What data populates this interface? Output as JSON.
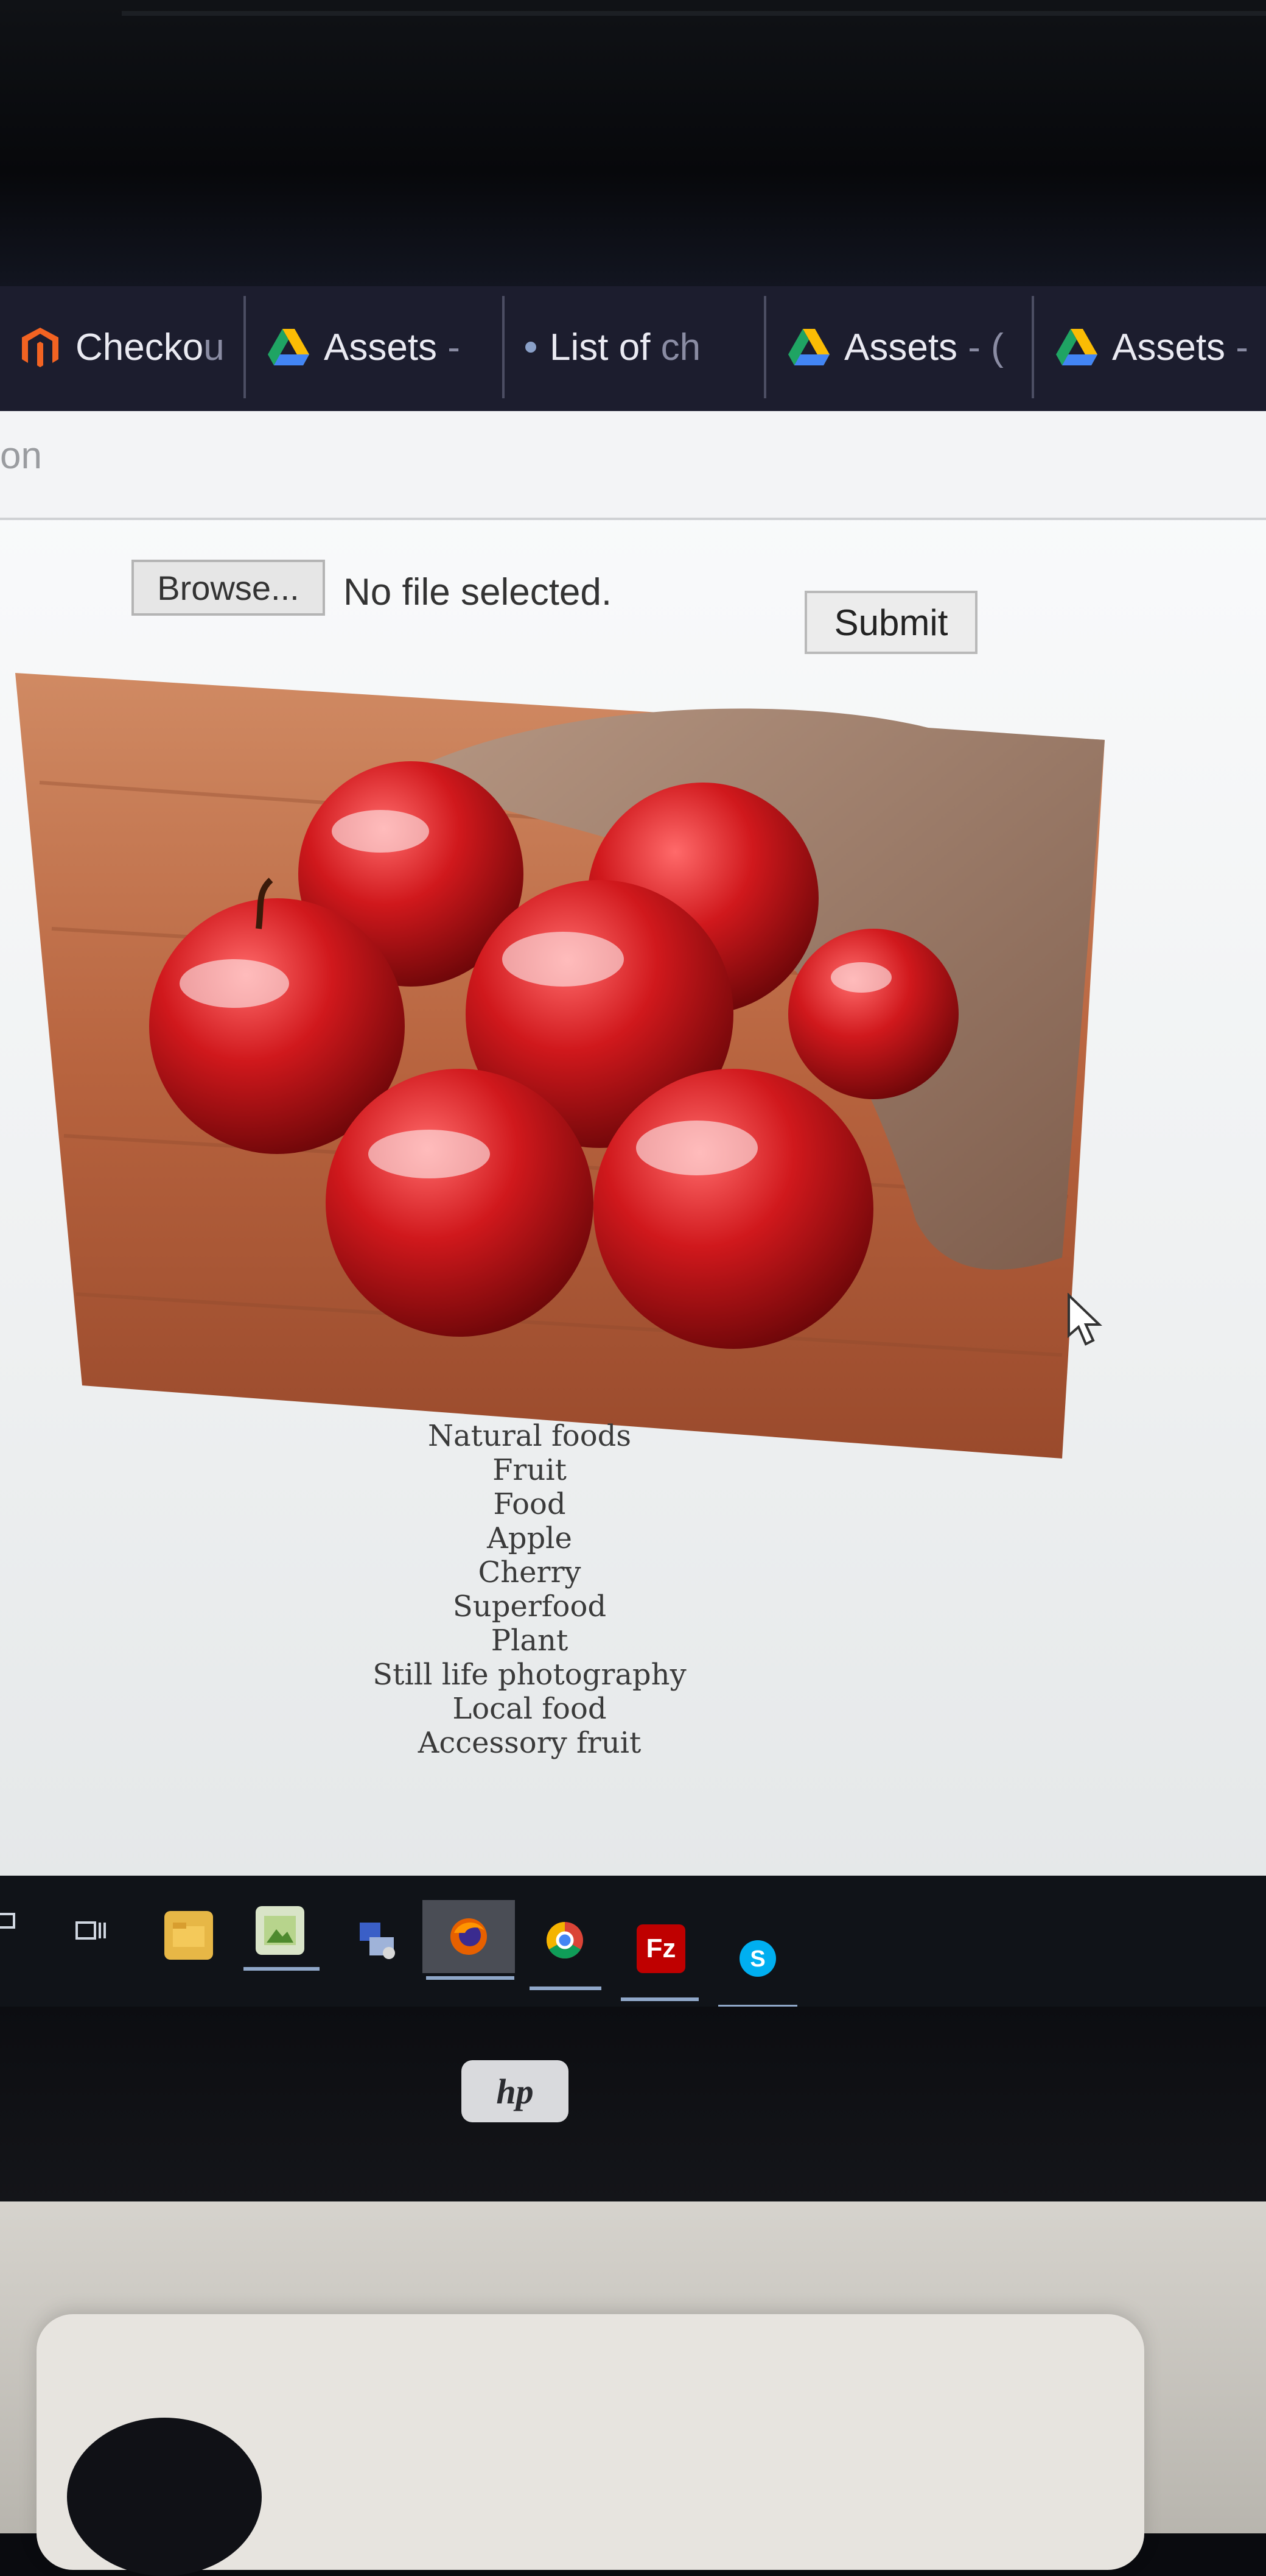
{
  "browser": {
    "tabs": [
      {
        "label": "Checko",
        "faded": "u",
        "icon": "magento-icon"
      },
      {
        "label": "Assets",
        "faded": " -",
        "icon": "google-drive-icon"
      },
      {
        "label": "List of",
        "faded": " ch",
        "icon": "page-icon"
      },
      {
        "label": "Assets",
        "faded": " - (",
        "icon": "google-drive-icon"
      },
      {
        "label": "Assets",
        "faded": " -",
        "icon": "google-drive-icon"
      }
    ],
    "address_fragment": "on"
  },
  "upload_form": {
    "browse_label": "Browse...",
    "file_status": "No file selected.",
    "submit_label": "Submit"
  },
  "image_labels": [
    "Natural foods",
    "Fruit",
    "Food",
    "Apple",
    "Cherry",
    "Superfood",
    "Plant",
    "Still life photography",
    "Local food",
    "Accessory fruit"
  ],
  "monitor": {
    "brand": "hp"
  },
  "taskbar": {
    "icons": [
      "task-view-icon",
      "file-explorer-icon",
      "image-viewer-icon",
      "network-icon",
      "firefox-icon",
      "chrome-icon",
      "filezilla-icon",
      "skype-icon"
    ]
  }
}
